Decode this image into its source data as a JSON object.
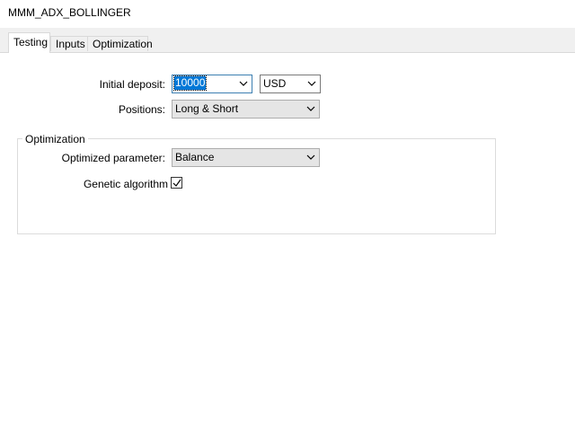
{
  "window": {
    "title": "MMM_ADX_BOLLINGER"
  },
  "tabs": [
    {
      "label": "Testing",
      "active": true
    },
    {
      "label": "Inputs",
      "active": false
    },
    {
      "label": "Optimization",
      "active": false
    }
  ],
  "testing": {
    "initial_deposit_label": "Initial deposit:",
    "initial_deposit_value": "10000",
    "currency_value": "USD",
    "positions_label": "Positions:",
    "positions_value": "Long & Short"
  },
  "optimization_group": {
    "title": "Optimization",
    "optimized_parameter_label": "Optimized parameter:",
    "optimized_parameter_value": "Balance",
    "genetic_algorithm_label": "Genetic algorithm",
    "genetic_algorithm_checked": true
  },
  "icons": {
    "dropdown": "chevron-down-icon",
    "check": "checkmark-icon"
  },
  "colors": {
    "selection": "#0078d7",
    "tabstrip": "#f0f0f0",
    "combo_gray": "#e5e5e5",
    "focus_border": "#3c7fb1"
  }
}
